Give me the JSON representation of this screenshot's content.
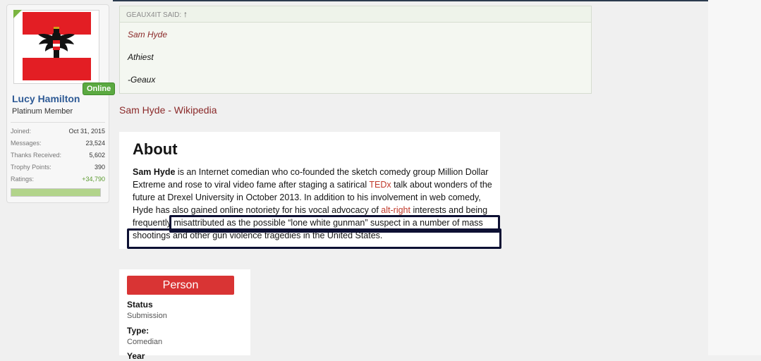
{
  "user": {
    "name": "Lucy Hamilton",
    "title": "Platinum Member",
    "online_badge": "Online",
    "stats": [
      {
        "label": "Joined:",
        "value": "Oct 31, 2015"
      },
      {
        "label": "Messages:",
        "value": "23,524"
      },
      {
        "label": "Thanks Received:",
        "value": "5,602"
      },
      {
        "label": "Trophy Points:",
        "value": "390"
      },
      {
        "label": "Ratings:",
        "value": "+34,790"
      }
    ]
  },
  "quote": {
    "header": "GEAUX4IT SAID:",
    "arrow": "↑",
    "lines": [
      "Sam Hyde",
      "Athiest",
      "-Geaux"
    ]
  },
  "post": {
    "link": "Sam Hyde - Wikipedia",
    "about": {
      "heading": "About",
      "subject": "Sam Hyde",
      "t1": " is an Internet comedian who co-founded the sketch comedy group Million Dollar Extreme and rose to viral video fame after staging a satirical ",
      "link1": "TEDx",
      "t2": " talk about wonders of the future at Drexel University in October 2013. In addition to his involvement in web comedy, Hyde has also gained online notoriety for his vocal advocacy of ",
      "link2": "alt-right",
      "t3": " interests and being frequently misattributed as the possible “lone white gunman” suspect in a number of mass shootings and other gun violence tragedies in the United States."
    },
    "person": {
      "button": "Person",
      "fields": [
        {
          "label": "Status",
          "value": "Submission"
        },
        {
          "label": "Type:",
          "value": "Comedian"
        },
        {
          "label": "Year",
          "value": ""
        }
      ]
    }
  },
  "colors": {
    "accent_red": "#d93434",
    "link_red": "#8b2a2a",
    "online_green": "#5ba941",
    "name_blue": "#2e5a95"
  }
}
